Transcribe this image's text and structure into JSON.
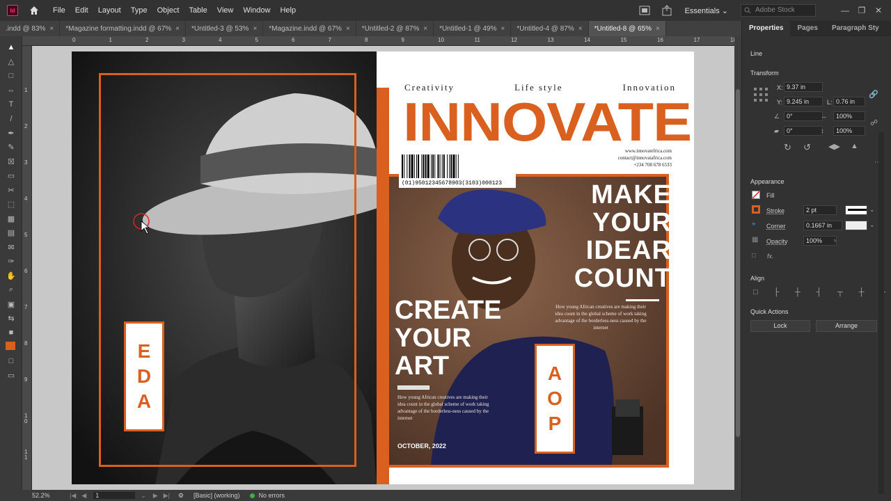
{
  "app": {
    "logo_text": "Id"
  },
  "menu": [
    "File",
    "Edit",
    "Layout",
    "Type",
    "Object",
    "Table",
    "View",
    "Window",
    "Help"
  ],
  "workspace": "Essentials",
  "search_placeholder": "Adobe Stock",
  "tabs": [
    {
      "label": ".indd @ 83%",
      "active": false
    },
    {
      "label": "*Magazine formatting.indd @ 67%",
      "active": false
    },
    {
      "label": "*Untitled-3 @ 53%",
      "active": false
    },
    {
      "label": "*Magazine.indd @ 67%",
      "active": false
    },
    {
      "label": "*Untitled-2 @ 87%",
      "active": false
    },
    {
      "label": "*Untitled-1 @ 49%",
      "active": false
    },
    {
      "label": "*Untitled-4 @ 87%",
      "active": false
    },
    {
      "label": "*Untitled-8 @ 65%",
      "active": true
    }
  ],
  "ruler_top": [
    "0",
    "1",
    "2",
    "3",
    "4",
    "5",
    "6",
    "7",
    "8",
    "9",
    "10",
    "11",
    "12",
    "13",
    "14",
    "15",
    "16",
    "17",
    "18"
  ],
  "ruler_left": [
    "1",
    "2",
    "3",
    "4",
    "5",
    "6",
    "7",
    "8",
    "9",
    "1\n0",
    "1\n1"
  ],
  "panel": {
    "tabs": [
      "Properties",
      "Pages",
      "Paragraph Sty"
    ],
    "section_line": "Line",
    "section_transform": "Transform",
    "x_label": "X:",
    "x_value": "9.37 in",
    "y_label": "Y:",
    "y_value": "9.245 in",
    "l_label": "L:",
    "l_value": "0.76 in",
    "rotate_value": "0°",
    "scale_x_value": "100%",
    "shear_value": "0°",
    "scale_y_value": "100%",
    "section_appearance": "Appearance",
    "fill_label": "Fill",
    "stroke_label": "Stroke",
    "stroke_value": "2 pt",
    "corner_label": "Corner",
    "corner_value": "0.1667 in",
    "opacity_label": "Opacity",
    "opacity_value": "100%",
    "fx_label": "fx.",
    "section_align": "Align",
    "section_quick": "Quick Actions",
    "lock_label": "Lock",
    "arrange_label": "Arrange"
  },
  "status": {
    "zoom": "52.2%",
    "page": "1",
    "preflight_profile": "[Basic] (working)",
    "errors": "No errors"
  },
  "magazine": {
    "tagline_1": "Creativity",
    "tagline_2": "Life style",
    "tagline_3": "Innovation",
    "masthead": "INNOVATE",
    "website": "www.innovatefrica.com",
    "email": "contact@innovatafrica.com",
    "phone": "+234 708 678 6533",
    "barcode_number": "(01)95012345678903(3103)000123",
    "headline_right_1": "MAKE",
    "headline_right_2": "YOUR",
    "headline_right_3": "IDEAR",
    "headline_right_4": "COUNT",
    "body_right": "How young African creatives are making their idea count in the global scheme of work taking advantage of the borderless-ness caused by the internet",
    "headline_left_1": "CREATE",
    "headline_left_2": "YOUR",
    "headline_left_3": "ART",
    "body_left": "How young African creatives are making their idea count in the global scheme of work taking advantage of the borderless-ness caused by the internet",
    "date": "OCTOBER, 2022",
    "vertical_right": [
      "A",
      "O",
      "P"
    ],
    "vertical_left": [
      "E",
      "D",
      "A"
    ]
  },
  "colors": {
    "accent": "#d9601f",
    "app_bg": "#535353",
    "menubar": "#323232"
  }
}
